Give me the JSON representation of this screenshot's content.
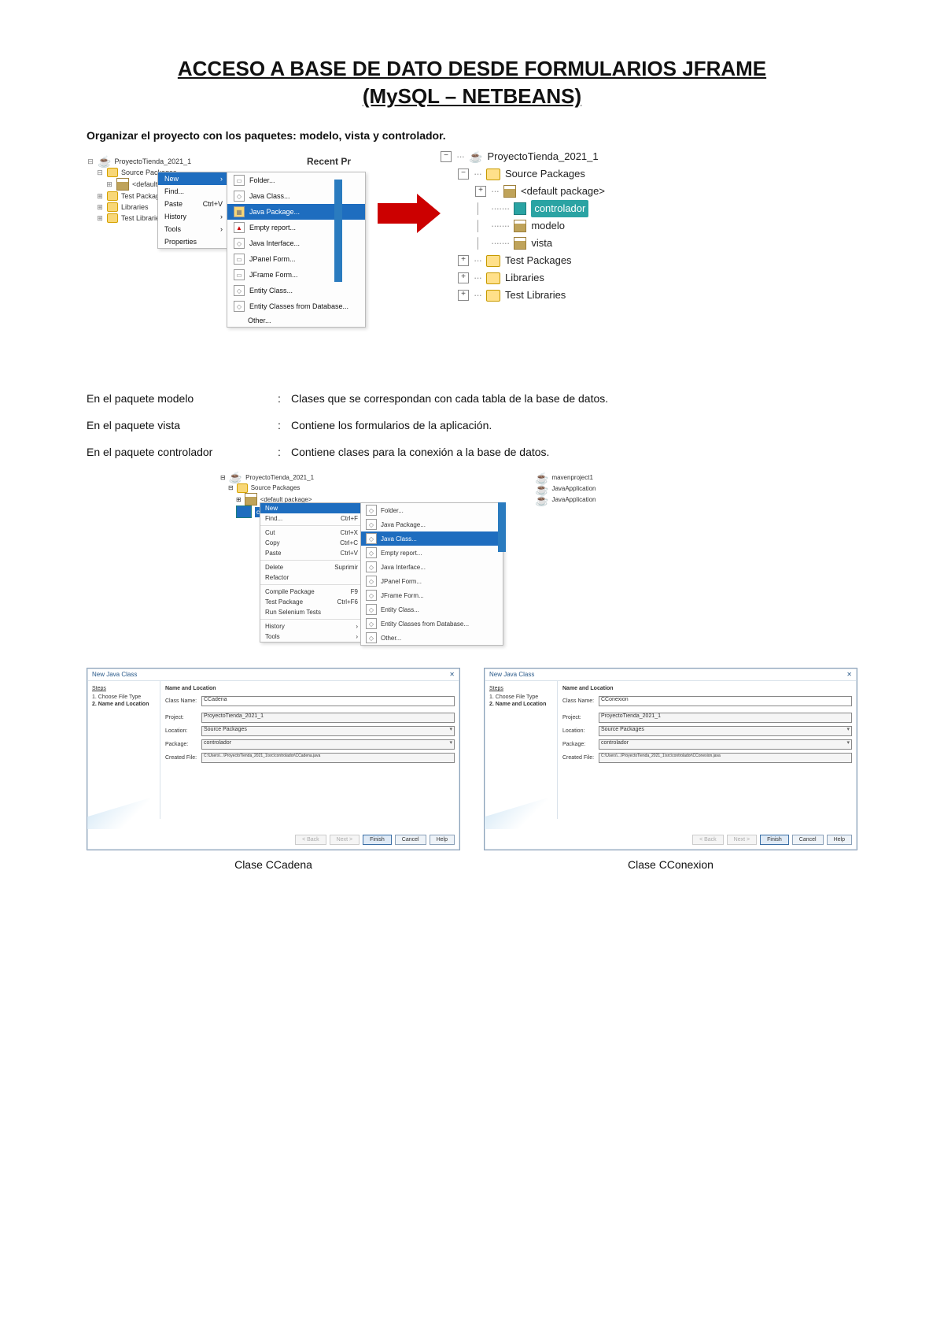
{
  "title_line1": "ACCESO A BASE DE DATO DESDE FORMULARIOS JFRAME",
  "title_line2": "(MySQL – NETBEANS)",
  "intro": "Organizar el proyecto con los paquetes: modelo, vista y controlador.",
  "left_tree": {
    "project": "ProyectoTienda_2021_1",
    "source_packages": "Source Packages",
    "default_package": "<default package>",
    "test_packages": "Test Packages",
    "libraries": "Libraries",
    "test_libraries": "Test Libraries"
  },
  "ctx1": [
    "New",
    "Find...",
    "Paste",
    "History",
    "Tools",
    "Properties"
  ],
  "ctx1_shortcut": "Ctrl+V",
  "ctx2": [
    "Folder...",
    "Java Class...",
    "Java Package...",
    "Empty report...",
    "Java Interface...",
    "JPanel Form...",
    "JFrame Form...",
    "Entity Class...",
    "Entity Classes from Database...",
    "Other..."
  ],
  "recent_label": "Recent Pr",
  "right_tree": {
    "project": "ProyectoTienda_2021_1",
    "source_packages": "Source Packages",
    "default_package": "<default package>",
    "pkg_controlador": "controlador",
    "pkg_modelo": "modelo",
    "pkg_vista": "vista",
    "test_packages": "Test Packages",
    "libraries": "Libraries",
    "test_libraries": "Test Libraries"
  },
  "defs": [
    {
      "l": "En el paquete modelo",
      "r": "Clases que se correspondan con cada tabla de la base de datos."
    },
    {
      "l": "En el paquete vista",
      "r": "Contiene los formularios de la aplicación."
    },
    {
      "l": "En el paquete controlador",
      "r": "Contiene clases para la conexión a la base de datos."
    }
  ],
  "mid": {
    "project": "ProyectoTienda_2021_1",
    "source_packages": "Source Packages",
    "default_package": "<default package>",
    "controlador": "controlador",
    "ctx1": [
      {
        "l": "New",
        "s": ""
      },
      {
        "l": "Find...",
        "s": "Ctrl+F"
      },
      {
        "l": "Cut",
        "s": "Ctrl+X"
      },
      {
        "l": "Copy",
        "s": "Ctrl+C"
      },
      {
        "l": "Paste",
        "s": "Ctrl+V"
      },
      {
        "l": "Delete",
        "s": "Suprimir"
      },
      {
        "l": "Refactor",
        "s": ""
      },
      {
        "l": "Compile Package",
        "s": "F9"
      },
      {
        "l": "Test Package",
        "s": "Ctrl+F6"
      },
      {
        "l": "Run Selenium Tests",
        "s": ""
      },
      {
        "l": "History",
        "s": "›"
      },
      {
        "l": "Tools",
        "s": "›"
      }
    ],
    "ctx2": [
      "Folder...",
      "Java Package...",
      "Java Class...",
      "Empty report...",
      "Java Interface...",
      "JPanel Form...",
      "JFrame Form...",
      "Entity Class...",
      "Entity Classes from Database...",
      "Other..."
    ],
    "right": [
      "mavenproject1",
      "JavaApplication",
      "JavaApplication"
    ]
  },
  "wiz_left": {
    "title": "New Java Class",
    "steps_hd": "Steps",
    "steps": [
      "1.  Choose File Type",
      "2.  Name and Location"
    ],
    "form_hd": "Name and Location",
    "class_lbl": "Class Name:",
    "class_val": "CCadena",
    "project_lbl": "Project:",
    "project_val": "ProyectoTienda_2021_1",
    "location_lbl": "Location:",
    "location_val": "Source Packages",
    "package_lbl": "Package:",
    "package_val": "controlador",
    "created_lbl": "Created File:",
    "created_val": "C:\\Users\\...\\ProyectoTienda_2021_1\\src\\controlador\\CCadena.java",
    "buttons": [
      "< Back",
      "Next >",
      "Finish",
      "Cancel",
      "Help"
    ]
  },
  "wiz_right": {
    "title": "New Java Class",
    "steps_hd": "Steps",
    "steps": [
      "1.  Choose File Type",
      "2.  Name and Location"
    ],
    "form_hd": "Name and Location",
    "class_lbl": "Class Name:",
    "class_val": "CConexion",
    "project_lbl": "Project:",
    "project_val": "ProyectoTienda_2021_1",
    "location_lbl": "Location:",
    "location_val": "Source Packages",
    "package_lbl": "Package:",
    "package_val": "controlador",
    "created_lbl": "Created File:",
    "created_val": "C:\\Users\\...\\ProyectoTienda_2021_1\\src\\controlador\\CConexion.java",
    "buttons": [
      "< Back",
      "Next >",
      "Finish",
      "Cancel",
      "Help"
    ]
  },
  "captions": [
    "Clase CCadena",
    "Clase CConexion"
  ],
  "colon": ":"
}
